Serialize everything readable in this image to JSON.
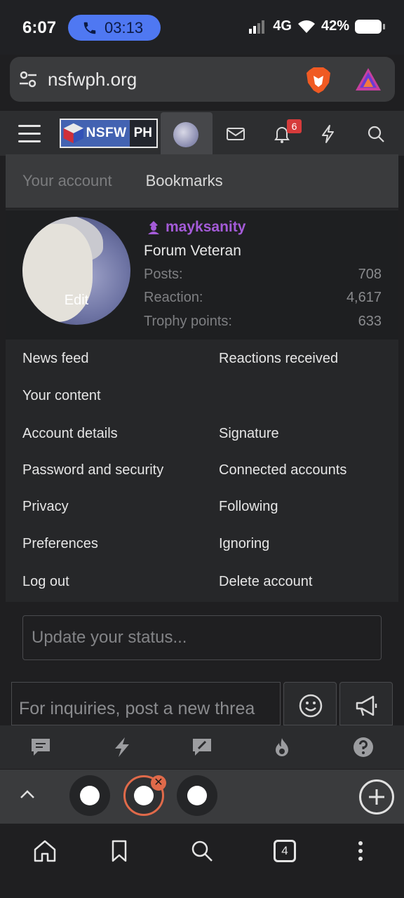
{
  "status_bar": {
    "time": "6:07",
    "call_timer": "03:13",
    "network": "4G",
    "battery": "42%"
  },
  "browser": {
    "url": "nsfwph.org"
  },
  "site": {
    "logo_main": "NSFW",
    "logo_suffix": "PH",
    "notification_count": "6"
  },
  "account_menu": {
    "tabs": [
      "Your account",
      "Bookmarks"
    ],
    "avatar_edit_label": "Edit",
    "username": "mayksanity",
    "user_title": "Forum Veteran",
    "stats": [
      {
        "label": "Posts:",
        "value": "708"
      },
      {
        "label": "Reaction:",
        "value": "4,617"
      },
      {
        "label": "Trophy points:",
        "value": "633"
      }
    ],
    "links_left": [
      "News feed",
      "Your content",
      "Account details",
      "Password and security",
      "Privacy",
      "Preferences",
      "Log out"
    ],
    "links_right": [
      "Reactions received",
      "Signature",
      "Connected accounts",
      "Following",
      "Ignoring",
      "Delete account"
    ],
    "status_placeholder": "Update your status..."
  },
  "page": {
    "inquiry_placeholder": "For inquiries, post a new threa"
  },
  "tabs": {
    "open_count": "4"
  },
  "colors": {
    "username": "#a45bd8",
    "badge": "#d63b3b",
    "active_tab_ring": "#e06a4a",
    "call_pill": "#4f78f2"
  }
}
